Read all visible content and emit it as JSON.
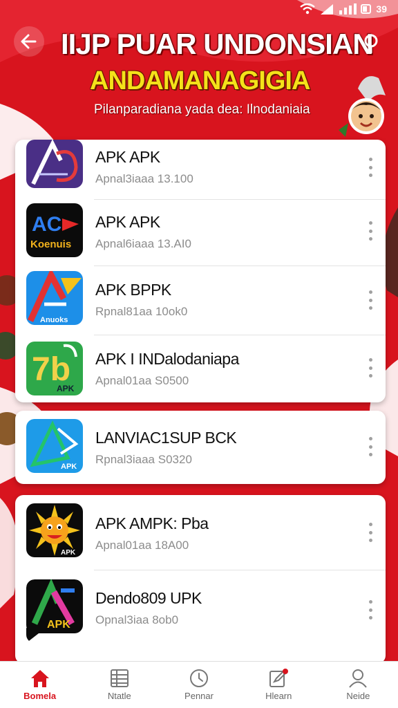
{
  "status_bar": {
    "battery_text": "39"
  },
  "header": {
    "title_line1": "IIJP PUAR UNDONSIAN",
    "title_line2": "ANDAMANAGIGIA",
    "subtitle": "Pilanparadiana yada dea: Ilnodaniaia"
  },
  "apps": [
    {
      "name": "APK APK",
      "subtitle": "Apnal3iaaa 13.100",
      "icon": "ac-logo-purple-icon",
      "icon_text": ""
    },
    {
      "name": "APK APK",
      "subtitle": "Apnal6iaaa 13.AI0",
      "icon": "ac-koenuis-icon",
      "icon_text": "Koenuis",
      "icon_mark": "AC"
    },
    {
      "name": "APK BPPK",
      "subtitle": "Rpnal81aa 10ok0",
      "icon": "a-triangle-blue-icon",
      "icon_text": "Anuoks"
    },
    {
      "name": "APK I INDalodaniapa",
      "subtitle": "Apnal01aa S0500",
      "icon": "7b-green-icon",
      "icon_text": "APK",
      "icon_mark": "7b"
    },
    {
      "name": "LANVIAC1SUP BCK",
      "subtitle": "Rpnal3iaaa S0320",
      "icon": "a-play-blue-icon",
      "icon_text": "APK"
    },
    {
      "name": "APK AMPK: Pba",
      "subtitle": "Apnal01aa 18A00",
      "icon": "sun-face-icon",
      "icon_text": "APK"
    },
    {
      "name": "Dendo809 UPK",
      "subtitle": "Opnal3iaa 8ob0",
      "icon": "a-rainbow-icon",
      "icon_text": "APK"
    }
  ],
  "nav": [
    {
      "label": "Bomela",
      "icon": "home-icon",
      "active": true
    },
    {
      "label": "Ntatle",
      "icon": "list-icon",
      "active": false
    },
    {
      "label": "Pennar",
      "icon": "clock-icon",
      "active": false
    },
    {
      "label": "Hlearn",
      "icon": "edit-icon",
      "active": false
    },
    {
      "label": "Neide",
      "icon": "profile-icon",
      "active": false
    }
  ],
  "colors": {
    "primary": "#d8141e",
    "title_yellow": "#f4e21a"
  }
}
